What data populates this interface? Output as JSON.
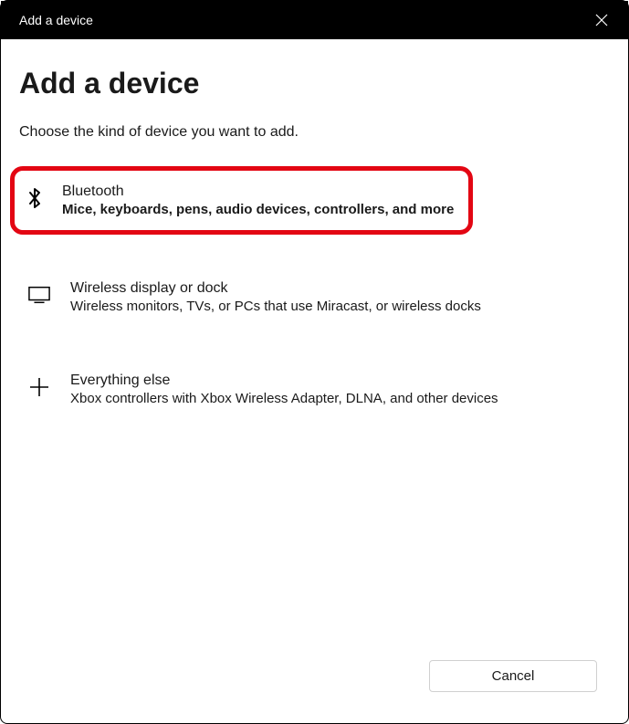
{
  "titlebar": {
    "title": "Add a device"
  },
  "heading": "Add a device",
  "subtitle": "Choose the kind of device you want to add.",
  "options": {
    "bluetooth": {
      "title": "Bluetooth",
      "desc": "Mice, keyboards, pens, audio devices, controllers, and more"
    },
    "wireless": {
      "title": "Wireless display or dock",
      "desc": "Wireless monitors, TVs, or PCs that use Miracast, or wireless docks"
    },
    "everything": {
      "title": "Everything else",
      "desc": "Xbox controllers with Xbox Wireless Adapter, DLNA, and other devices"
    }
  },
  "footer": {
    "cancel": "Cancel"
  }
}
